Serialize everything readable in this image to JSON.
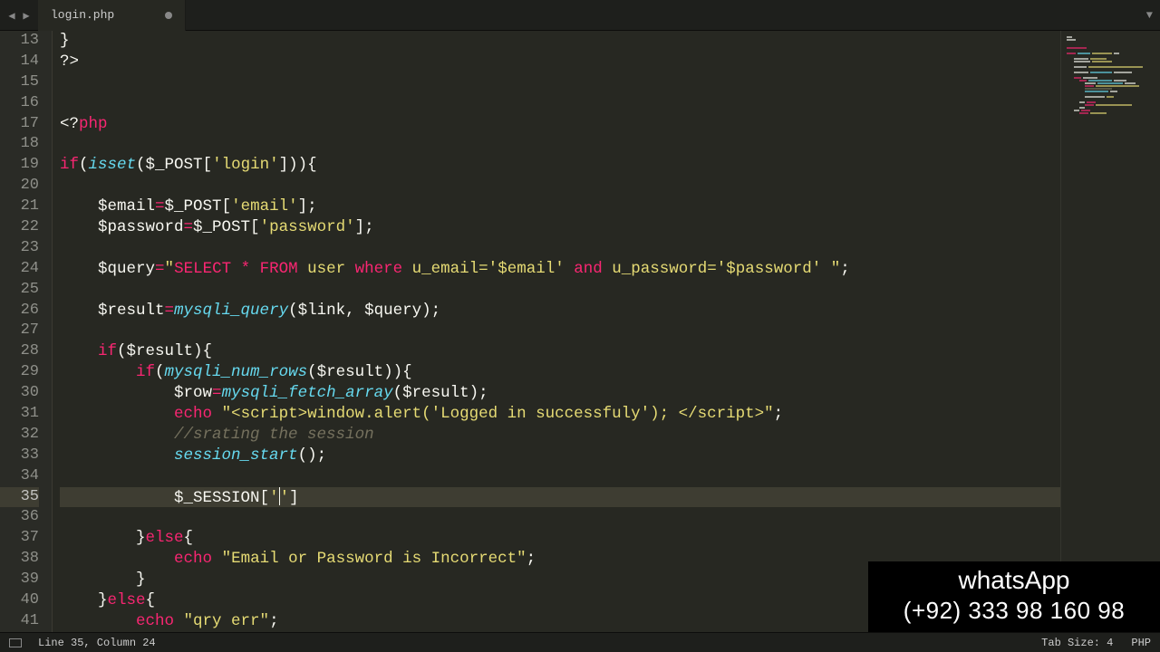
{
  "tab": {
    "filename": "login.php"
  },
  "lines": [
    {
      "n": 13,
      "html": "<span class='p'>}</span>"
    },
    {
      "n": 14,
      "html": "<span class='p'>?&gt;</span>"
    },
    {
      "n": 15,
      "html": ""
    },
    {
      "n": 16,
      "html": ""
    },
    {
      "n": 17,
      "html": "<span class='p'>&lt;?</span><span class='kw'>php</span>"
    },
    {
      "n": 18,
      "html": ""
    },
    {
      "n": 19,
      "html": "<span class='kw'>if</span><span class='p'>(</span><span class='fn'>isset</span><span class='p'>($_POST[</span><span class='str'>'login'</span><span class='p'>])){</span>"
    },
    {
      "n": 20,
      "html": ""
    },
    {
      "n": 21,
      "html": "    <span class='p'>$email</span><span class='kw'>=</span><span class='p'>$_POST[</span><span class='str'>'email'</span><span class='p'>];</span>"
    },
    {
      "n": 22,
      "html": "    <span class='p'>$password</span><span class='kw'>=</span><span class='p'>$_POST[</span><span class='str'>'password'</span><span class='p'>];</span>"
    },
    {
      "n": 23,
      "html": ""
    },
    {
      "n": 24,
      "html": "    <span class='p'>$query</span><span class='kw'>=</span><span class='str'>\"</span><span class='kw'>SELECT</span><span class='str'> </span><span class='kw'>*</span><span class='str'> </span><span class='kw'>FROM</span><span class='str'> user </span><span class='kw'>where</span><span class='str'> u_email='$email' </span><span class='kw'>and</span><span class='str'> u_password='$password' \"</span><span class='p'>;</span>"
    },
    {
      "n": 25,
      "html": ""
    },
    {
      "n": 26,
      "html": "    <span class='p'>$result</span><span class='kw'>=</span><span class='fn'>mysqli_query</span><span class='p'>($link, $query);</span>"
    },
    {
      "n": 27,
      "html": ""
    },
    {
      "n": 28,
      "html": "    <span class='kw'>if</span><span class='p'>($result){</span>"
    },
    {
      "n": 29,
      "html": "        <span class='kw'>if</span><span class='p'>(</span><span class='fn'>mysqli_num_rows</span><span class='p'>($result)){</span>"
    },
    {
      "n": 30,
      "html": "            <span class='p'>$row</span><span class='kw'>=</span><span class='fn'>mysqli_fetch_array</span><span class='p'>($result);</span>"
    },
    {
      "n": 31,
      "html": "            <span class='kw'>echo</span><span class='p'> </span><span class='str'>\"&lt;script&gt;window.alert('Logged in successfuly'); &lt;/script&gt;\"</span><span class='p'>;</span>"
    },
    {
      "n": 32,
      "html": "            <span class='cmt'>//srating the session</span>"
    },
    {
      "n": 33,
      "html": "            <span class='fn'>session_start</span><span class='p'>();</span>"
    },
    {
      "n": 34,
      "html": ""
    },
    {
      "n": 35,
      "html": "            <span class='p'>$_SESSION[</span><span class='str'>'</span><span class='cur'></span><span class='str'>'</span><span class='p'>]</span>",
      "active": true
    },
    {
      "n": 36,
      "html": ""
    },
    {
      "n": 37,
      "html": "        <span class='p'>}</span><span class='kw'>else</span><span class='p'>{</span>"
    },
    {
      "n": 38,
      "html": "            <span class='kw'>echo</span><span class='p'> </span><span class='str'>\"Email or Password is Incorrect\"</span><span class='p'>;</span>"
    },
    {
      "n": 39,
      "html": "        <span class='p'>}</span>"
    },
    {
      "n": 40,
      "html": "    <span class='p'>}</span><span class='kw'>else</span><span class='p'>{</span>"
    },
    {
      "n": 41,
      "html": "        <span class='kw'>echo</span><span class='p'> </span><span class='str'>\"qry err\"</span><span class='p'>;</span>"
    }
  ],
  "status": {
    "pos": "Line 35, Column 24",
    "tabsize": "Tab Size: 4",
    "lang": "PHP"
  },
  "watermark": {
    "l1": "whatsApp",
    "l2": "(+92) 333 98 160 98"
  },
  "minimap": [
    [
      [
        0,
        6,
        "#f8f8f2"
      ]
    ],
    [
      [
        0,
        10,
        "#f8f8f2"
      ]
    ],
    [],
    [],
    [
      [
        0,
        22,
        "#f92672"
      ]
    ],
    [],
    [
      [
        0,
        10,
        "#f92672"
      ],
      [
        12,
        14,
        "#66d9ef"
      ],
      [
        28,
        22,
        "#e6db74"
      ],
      [
        52,
        6,
        "#f8f8f2"
      ]
    ],
    [],
    [
      [
        8,
        16,
        "#f8f8f2"
      ],
      [
        26,
        18,
        "#e6db74"
      ]
    ],
    [
      [
        8,
        18,
        "#f8f8f2"
      ],
      [
        28,
        22,
        "#e6db74"
      ]
    ],
    [],
    [
      [
        8,
        14,
        "#f8f8f2"
      ],
      [
        24,
        60,
        "#e6db74"
      ]
    ],
    [],
    [
      [
        8,
        16,
        "#f8f8f2"
      ],
      [
        26,
        24,
        "#66d9ef"
      ],
      [
        52,
        20,
        "#f8f8f2"
      ]
    ],
    [],
    [
      [
        8,
        8,
        "#f92672"
      ],
      [
        18,
        16,
        "#f8f8f2"
      ]
    ],
    [
      [
        14,
        8,
        "#f92672"
      ],
      [
        24,
        26,
        "#66d9ef"
      ],
      [
        52,
        14,
        "#f8f8f2"
      ]
    ],
    [
      [
        20,
        12,
        "#f8f8f2"
      ],
      [
        34,
        28,
        "#66d9ef"
      ],
      [
        64,
        12,
        "#f8f8f2"
      ]
    ],
    [
      [
        20,
        10,
        "#f92672"
      ],
      [
        32,
        48,
        "#e6db74"
      ]
    ],
    [
      [
        20,
        30,
        "#75715e"
      ]
    ],
    [
      [
        20,
        26,
        "#66d9ef"
      ],
      [
        48,
        8,
        "#f8f8f2"
      ]
    ],
    [],
    [
      [
        20,
        22,
        "#f8f8f2"
      ],
      [
        44,
        8,
        "#e6db74"
      ]
    ],
    [],
    [
      [
        14,
        6,
        "#f8f8f2"
      ],
      [
        22,
        10,
        "#f92672"
      ]
    ],
    [
      [
        20,
        10,
        "#f92672"
      ],
      [
        32,
        40,
        "#e6db74"
      ]
    ],
    [
      [
        14,
        6,
        "#f8f8f2"
      ]
    ],
    [
      [
        8,
        6,
        "#f8f8f2"
      ],
      [
        16,
        10,
        "#f92672"
      ]
    ],
    [
      [
        14,
        10,
        "#f92672"
      ],
      [
        26,
        18,
        "#e6db74"
      ]
    ]
  ]
}
